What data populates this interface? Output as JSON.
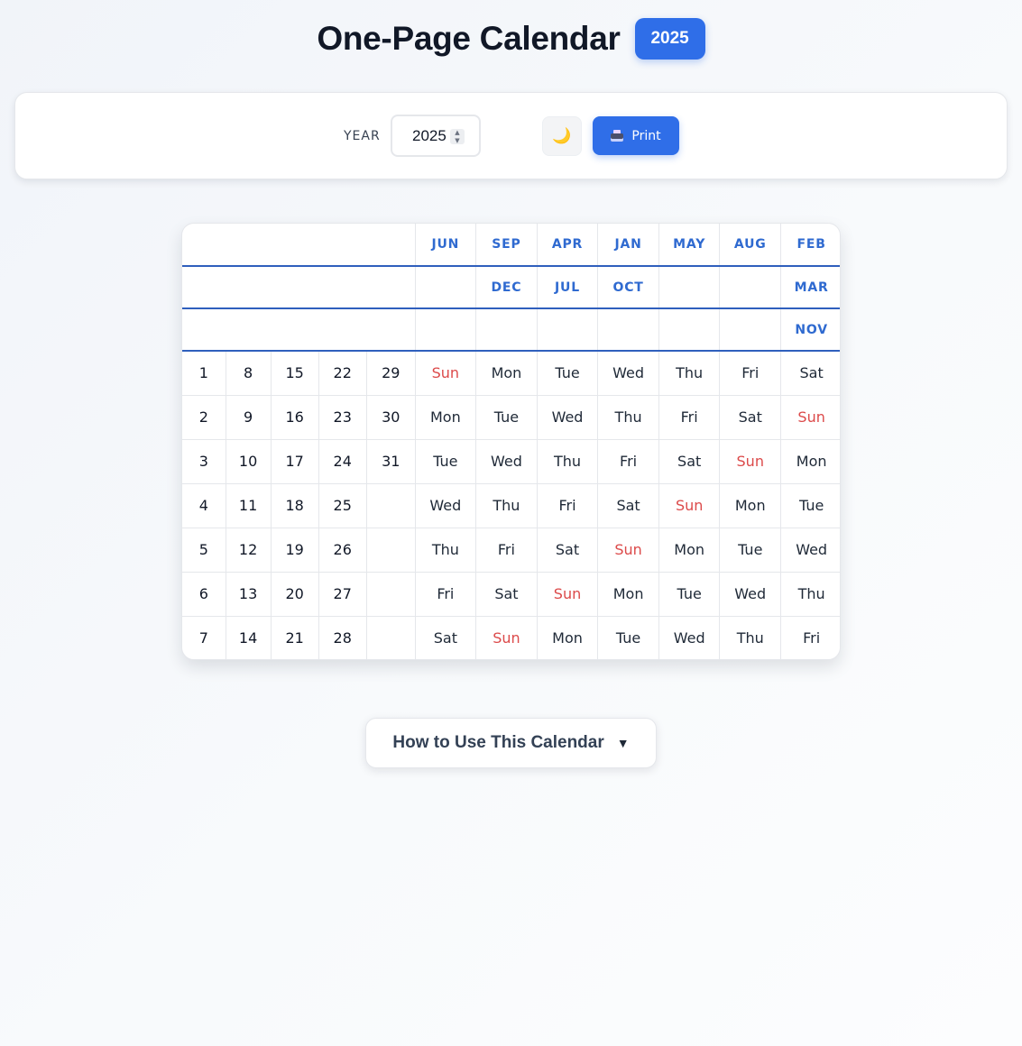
{
  "header": {
    "title": "One-Page Calendar",
    "year_badge": "2025"
  },
  "controls": {
    "year_label": "YEAR",
    "year_value": "2025",
    "theme_icon": "🌙",
    "print_label": "Print"
  },
  "calendar": {
    "month_rows": [
      [
        "",
        "",
        "",
        "",
        "",
        "JUN",
        "SEP",
        "APR",
        "JAN",
        "MAY",
        "AUG",
        "FEB"
      ],
      [
        "",
        "",
        "",
        "",
        "",
        "",
        "DEC",
        "JUL",
        "OCT",
        "",
        "",
        "MAR"
      ],
      [
        "",
        "",
        "",
        "",
        "",
        "",
        "",
        "",
        "",
        "",
        "",
        "NOV"
      ]
    ],
    "day_rows": [
      [
        "1",
        "8",
        "15",
        "22",
        "29",
        "Sun",
        "Mon",
        "Tue",
        "Wed",
        "Thu",
        "Fri",
        "Sat"
      ],
      [
        "2",
        "9",
        "16",
        "23",
        "30",
        "Mon",
        "Tue",
        "Wed",
        "Thu",
        "Fri",
        "Sat",
        "Sun"
      ],
      [
        "3",
        "10",
        "17",
        "24",
        "31",
        "Tue",
        "Wed",
        "Thu",
        "Fri",
        "Sat",
        "Sun",
        "Mon"
      ],
      [
        "4",
        "11",
        "18",
        "25",
        "",
        "Wed",
        "Thu",
        "Fri",
        "Sat",
        "Sun",
        "Mon",
        "Tue"
      ],
      [
        "5",
        "12",
        "19",
        "26",
        "",
        "Thu",
        "Fri",
        "Sat",
        "Sun",
        "Mon",
        "Tue",
        "Wed"
      ],
      [
        "6",
        "13",
        "20",
        "27",
        "",
        "Fri",
        "Sat",
        "Sun",
        "Mon",
        "Tue",
        "Wed",
        "Thu"
      ],
      [
        "7",
        "14",
        "21",
        "28",
        "",
        "Sat",
        "Sun",
        "Mon",
        "Tue",
        "Wed",
        "Thu",
        "Fri"
      ]
    ],
    "colors": {
      "accent": "#2f6ee8",
      "month_text": "#2f6ad0",
      "sunday": "#dc4a4a"
    }
  },
  "help": {
    "label": "How to Use This Calendar",
    "caret": "▼"
  }
}
